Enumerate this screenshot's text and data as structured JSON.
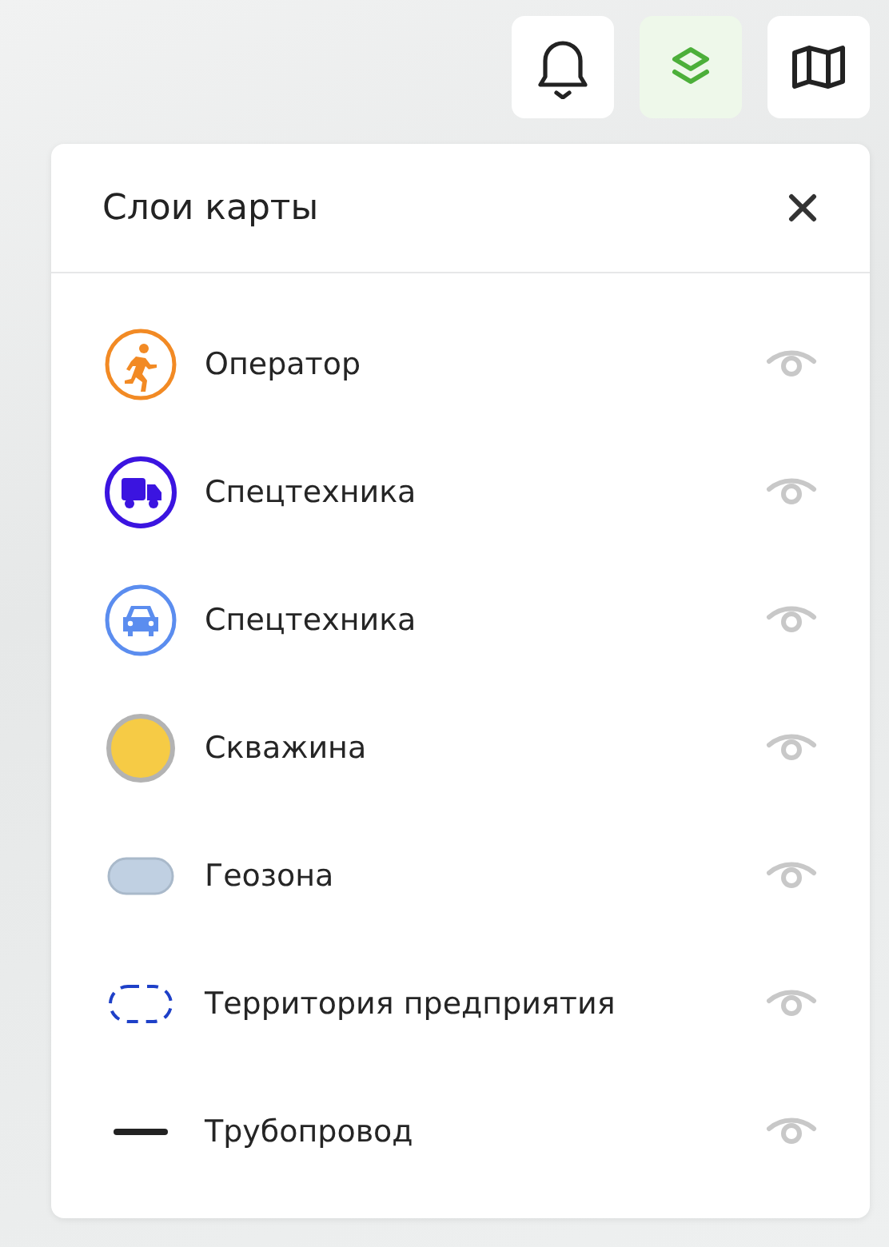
{
  "toolbar": [
    {
      "kind": "bell",
      "selected": false
    },
    {
      "kind": "layers",
      "selected": true
    },
    {
      "kind": "map",
      "selected": false
    }
  ],
  "panel": {
    "title": "Слои карты",
    "layers": [
      {
        "kind": "operator",
        "label": "Оператор"
      },
      {
        "kind": "truck",
        "label": "Спецтехника"
      },
      {
        "kind": "car",
        "label": "Спецтехника"
      },
      {
        "kind": "well",
        "label": "Скважина"
      },
      {
        "kind": "geozone",
        "label": "Геозона"
      },
      {
        "kind": "territory",
        "label": "Территория предприятия"
      },
      {
        "kind": "pipeline",
        "label": "Трубопровод"
      }
    ]
  }
}
